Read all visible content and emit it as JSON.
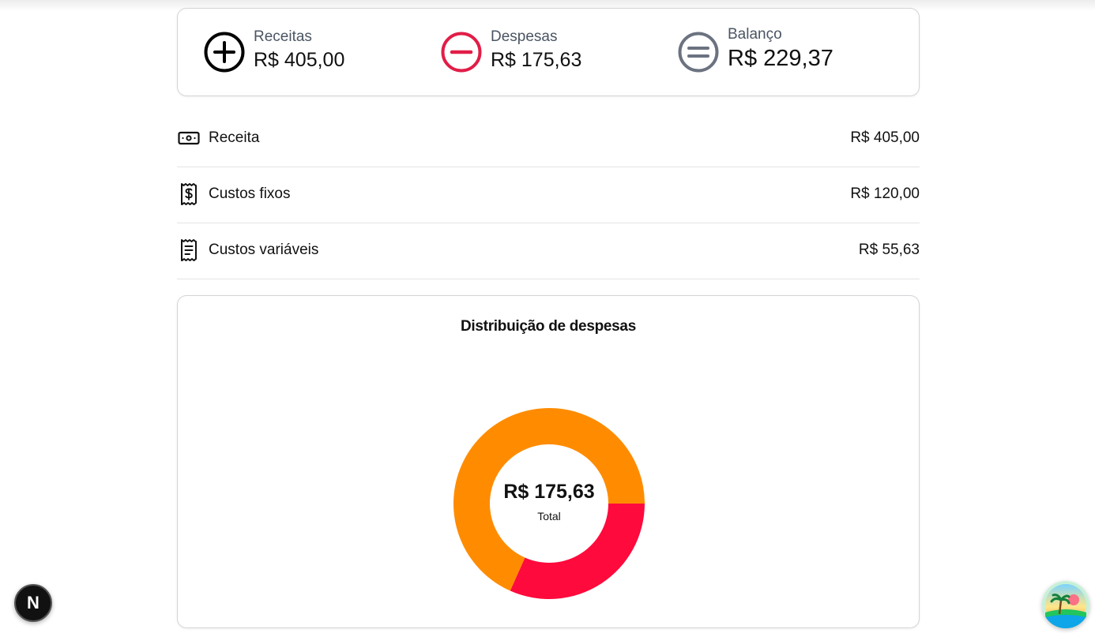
{
  "summary": {
    "income": {
      "label": "Receitas",
      "value": "R$ 405,00",
      "icon": "plus-circle-icon",
      "color": "#000000"
    },
    "expenses": {
      "label": "Despesas",
      "value": "R$ 175,63",
      "icon": "minus-circle-icon",
      "color": "#e11d48"
    },
    "balance": {
      "label": "Balanço",
      "value": "R$ 229,37",
      "icon": "equals-circle-icon",
      "color": "#6b7280"
    }
  },
  "rows": [
    {
      "label": "Receita",
      "value": "R$ 405,00",
      "icon": "banknote-icon"
    },
    {
      "label": "Custos fixos",
      "value": "R$ 120,00",
      "icon": "receipt-dollar-icon"
    },
    {
      "label": "Custos variáveis",
      "value": "R$ 55,63",
      "icon": "receipt-text-icon"
    }
  ],
  "chart_data": {
    "type": "pie",
    "title": "Distribuição de despesas",
    "center_value": "R$ 175,63",
    "center_caption": "Total",
    "slices": [
      {
        "value": 120.0,
        "color": "#ff8c00"
      },
      {
        "value": 55.63,
        "color": "#ff0a3c"
      }
    ]
  },
  "floating": {
    "next_label": "N",
    "avatar_icon": "beach-avatar-icon"
  }
}
